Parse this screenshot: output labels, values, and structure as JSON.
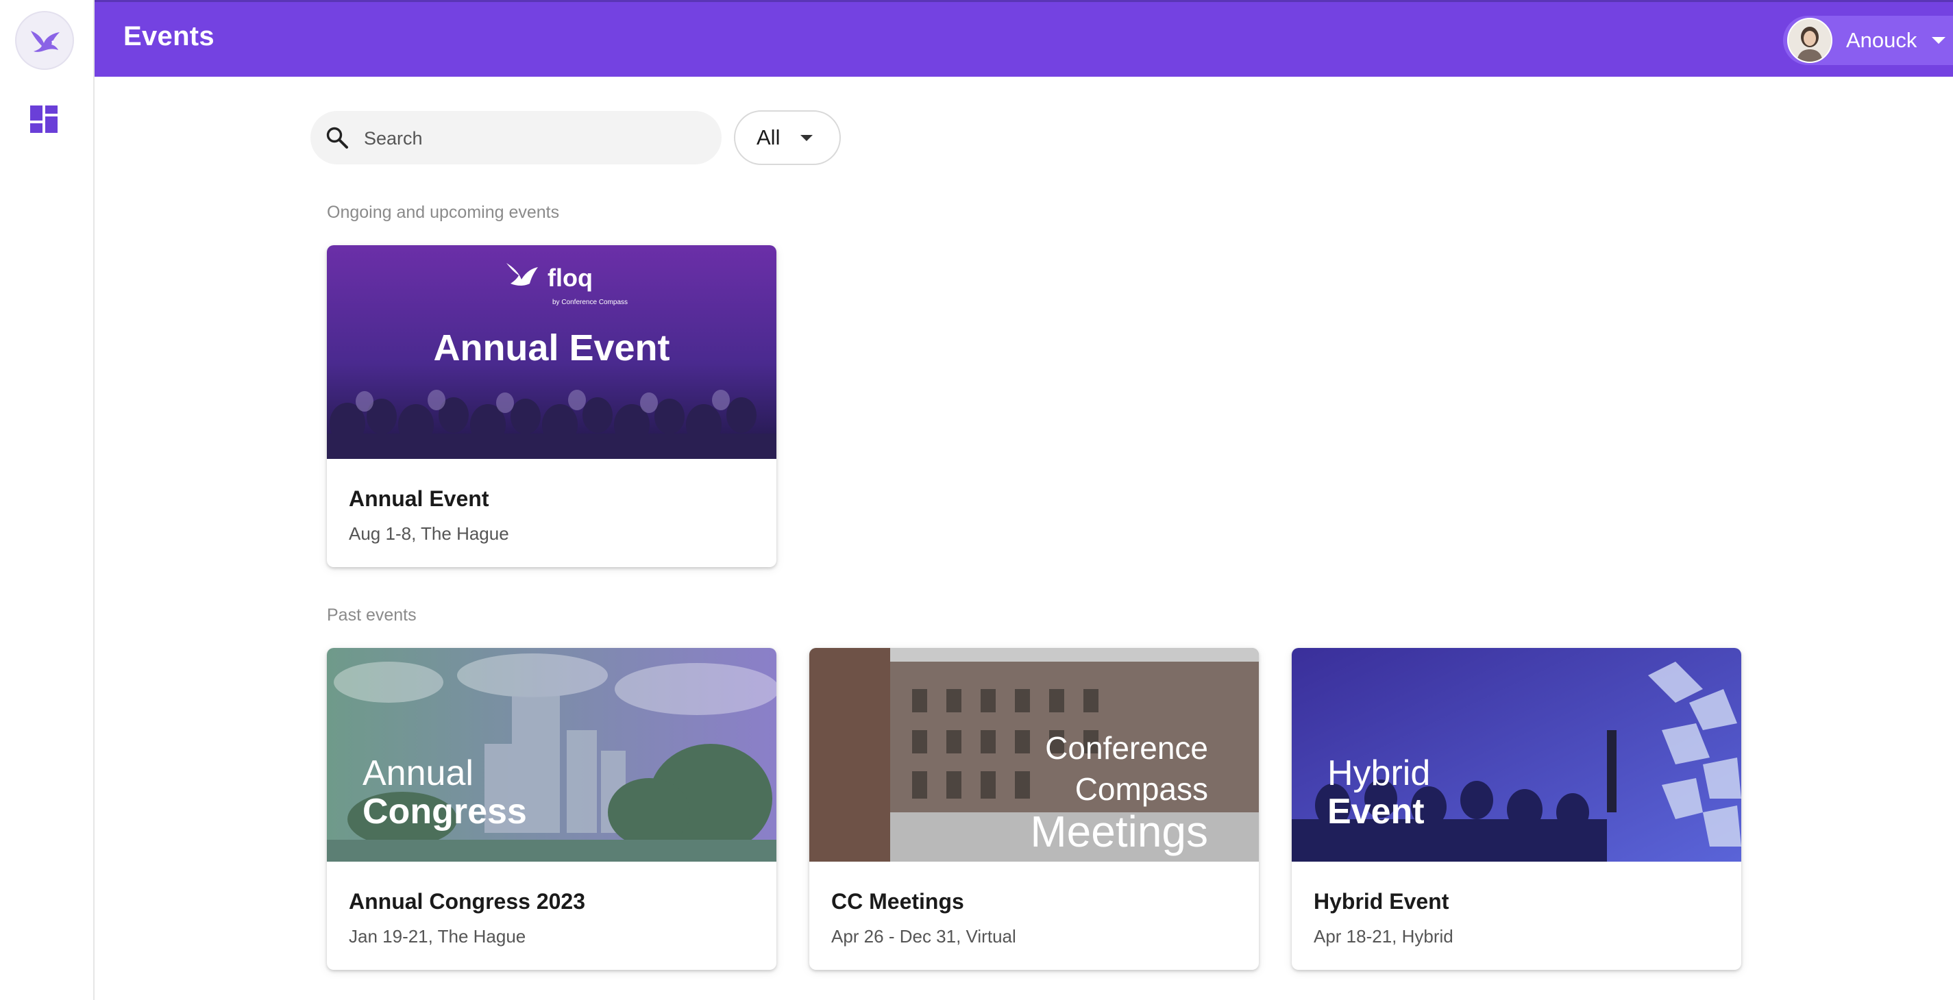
{
  "header": {
    "title": "Events"
  },
  "user": {
    "name": "Anouck"
  },
  "search": {
    "placeholder": "Search",
    "value": ""
  },
  "filter": {
    "selected": "All"
  },
  "sections": {
    "upcoming": "Ongoing and upcoming events",
    "past": "Past events"
  },
  "events": {
    "upcoming": [
      {
        "title": "Annual Event",
        "subtitle": "Aug 1-8, The Hague",
        "banner_brand": "floq",
        "banner_brand_sub": "by Conference Compass",
        "banner_text": "Annual Event"
      }
    ],
    "past": [
      {
        "title": "Annual Congress 2023",
        "subtitle": "Jan 19-21, The Hague",
        "banner_line1": "Annual",
        "banner_line2": "Congress"
      },
      {
        "title": "CC Meetings",
        "subtitle": "Apr 26 - Dec 31, Virtual",
        "banner_line1": "Conference",
        "banner_line2": "Compass",
        "banner_line3": "Meetings"
      },
      {
        "title": "Hybrid Event",
        "subtitle": "Apr 18-21, Hybrid",
        "banner_line1": "Hybrid",
        "banner_line2": "Event"
      }
    ]
  },
  "icons": {
    "app_logo": "bird-logo-icon",
    "nav_dashboard": "dashboard-icon",
    "search": "search-icon",
    "filter_caret": "caret-down-icon",
    "user_caret": "caret-down-icon"
  },
  "colors": {
    "brand": "#7442e1",
    "dashboard_icon": "#6a3fd8",
    "section_label": "#8a8a8a"
  }
}
